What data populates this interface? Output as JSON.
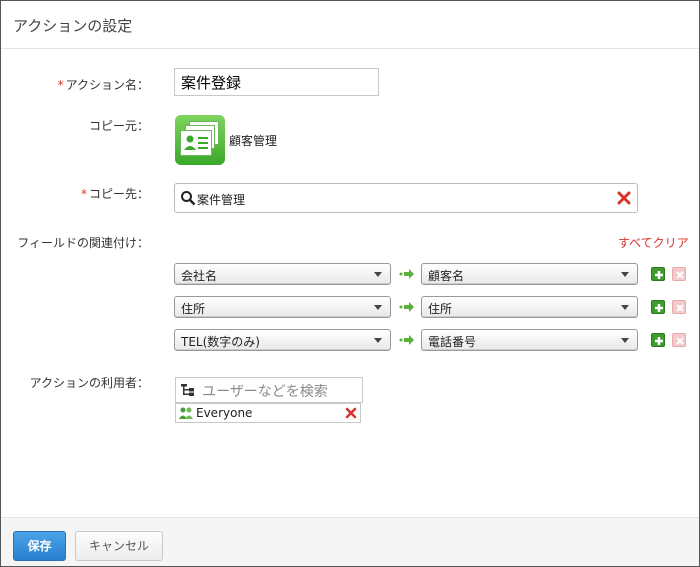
{
  "dialog": {
    "title": "アクションの設定"
  },
  "action_name": {
    "label": "アクション名：",
    "value": "案件登録"
  },
  "copy_source": {
    "label": "コピー元：",
    "app_name": "顧客管理"
  },
  "copy_dest": {
    "label": "コピー先：",
    "value": "案件管理"
  },
  "field_mapping": {
    "label": "フィールドの関連付け：",
    "clear_all": "すべてクリア",
    "rows": [
      {
        "source": "会社名",
        "dest": "顧客名"
      },
      {
        "source": "住所",
        "dest": "住所"
      },
      {
        "source": "TEL(数字のみ)",
        "dest": "電話番号"
      }
    ]
  },
  "users": {
    "label": "アクションの利用者：",
    "placeholder": "ユーザーなどを検索",
    "entries": [
      {
        "name": "Everyone"
      }
    ]
  },
  "footer": {
    "save_label": "保存",
    "cancel_label": "キャンセル"
  },
  "colors": {
    "required": "#d9312b",
    "save_button": "#2a7fcf",
    "add_button": "#3e9c2f",
    "app_icon": "#3aa82a"
  }
}
